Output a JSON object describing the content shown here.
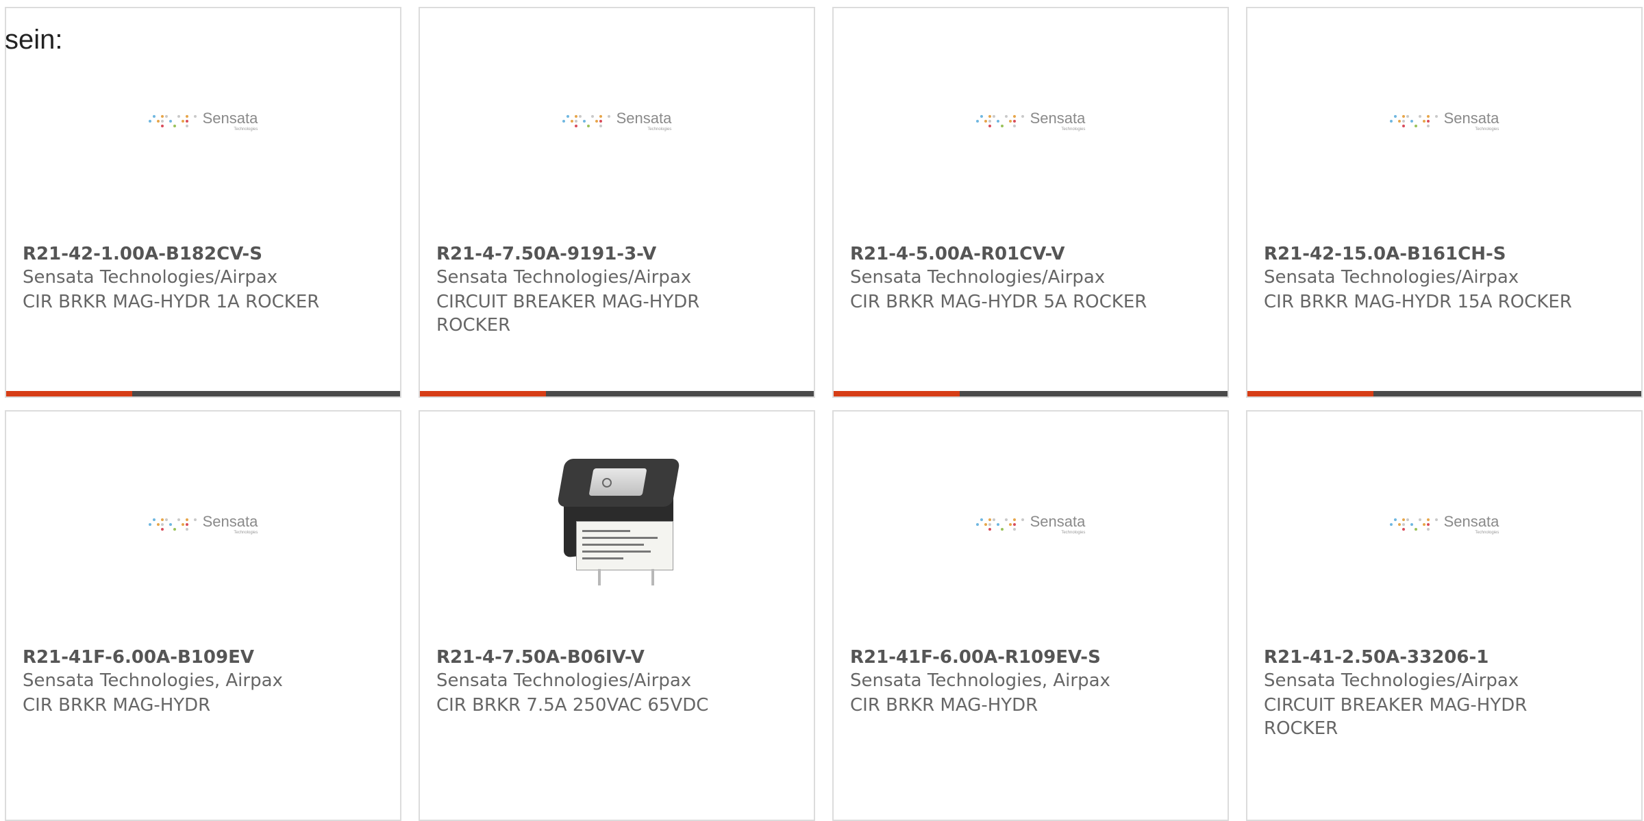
{
  "intro_text": "sein:",
  "logo": {
    "name": "Sensata",
    "sub": "Technologies"
  },
  "colors": {
    "accent": "#d63d16",
    "bar": "#4a4a4a",
    "border": "#dcdcdc",
    "text": "#666666"
  },
  "products": [
    {
      "part": "R21-42-1.00A-B182CV-S",
      "manufacturer": "Sensata Technologies/Airpax",
      "description": "CIR BRKR MAG-HYDR 1A ROCKER",
      "image": "sensata-logo"
    },
    {
      "part": "R21-4-7.50A-9191-3-V",
      "manufacturer": "Sensata Technologies/Airpax",
      "description": "CIRCUIT BREAKER MAG-HYDR ROCKER",
      "image": "sensata-logo"
    },
    {
      "part": "R21-4-5.00A-R01CV-V",
      "manufacturer": "Sensata Technologies/Airpax",
      "description": "CIR BRKR MAG-HYDR 5A ROCKER",
      "image": "sensata-logo"
    },
    {
      "part": "R21-42-15.0A-B161CH-S",
      "manufacturer": "Sensata Technologies/Airpax",
      "description": "CIR BRKR MAG-HYDR 15A ROCKER",
      "image": "sensata-logo"
    },
    {
      "part": "R21-41F-6.00A-B109EV",
      "manufacturer": "Sensata Technologies, Airpax",
      "description": "CIR BRKR MAG-HYDR",
      "image": "sensata-logo"
    },
    {
      "part": "R21-4-7.50A-B06IV-V",
      "manufacturer": "Sensata Technologies/Airpax",
      "description": "CIR BRKR 7.5A 250VAC 65VDC",
      "image": "product-photo"
    },
    {
      "part": "R21-41F-6.00A-R109EV-S",
      "manufacturer": "Sensata Technologies, Airpax",
      "description": "CIR BRKR MAG-HYDR",
      "image": "sensata-logo"
    },
    {
      "part": "R21-41-2.50A-33206-1",
      "manufacturer": "Sensata Technologies/Airpax",
      "description": "CIRCUIT BREAKER MAG-HYDR ROCKER",
      "image": "sensata-logo"
    }
  ]
}
